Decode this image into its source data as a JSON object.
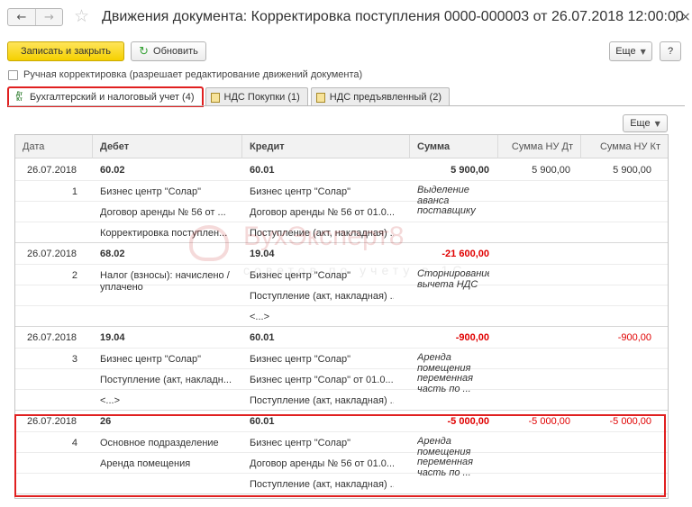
{
  "title": "Движения документа: Корректировка поступления 0000-000003 от 26.07.2018 12:00:00",
  "window": {
    "more_label": "⋮",
    "close_label": "×"
  },
  "toolbar": {
    "save_close": "Записать и закрыть",
    "refresh": "Обновить",
    "more": "Еще",
    "help": "?"
  },
  "manual_correction": {
    "label": "Ручная корректировка (разрешает редактирование движений документа)",
    "checked": false
  },
  "tabs": [
    {
      "label": "Бухгалтерский и налоговый учет (4)",
      "active": true,
      "icon": "dt-kt-icon"
    },
    {
      "label": "НДС Покупки (1)",
      "active": false,
      "icon": "register-icon"
    },
    {
      "label": "НДС предъявленный (2)",
      "active": false,
      "icon": "register-icon"
    }
  ],
  "grid_more": "Еще",
  "columns": [
    "Дата",
    "Дебет",
    "Кредит",
    "Сумма",
    "Сумма НУ Дт",
    "Сумма НУ Кт"
  ],
  "rows": [
    {
      "date": "26.07.2018",
      "num": "1",
      "debit": [
        "60.02",
        "Бизнес центр \"Солар\"",
        "Договор аренды № 56 от ...",
        "Корректировка поступлен..."
      ],
      "credit": [
        "60.01",
        "Бизнес центр \"Солар\"",
        "Договор аренды № 56 от 01.0...",
        "Поступление (акт, накладная) ..."
      ],
      "sum": "5 900,00",
      "content": "Выделение аванса поставщику",
      "nu_dt": "5 900,00",
      "nu_kt": "5 900,00"
    },
    {
      "date": "26.07.2018",
      "num": "2",
      "debit": [
        "68.02",
        "Налог (взносы): начислено / уплачено",
        "",
        ""
      ],
      "credit": [
        "19.04",
        "Бизнес центр \"Солар\"",
        "Поступление (акт, накладная) ...",
        "<...>"
      ],
      "sum": "-21 600,00",
      "content": "Сторнирование вычета НДС",
      "nu_dt": "",
      "nu_kt": ""
    },
    {
      "date": "26.07.2018",
      "num": "3",
      "debit": [
        "19.04",
        "Бизнес центр \"Солар\"",
        "Поступление (акт, накладн...",
        "<...>"
      ],
      "credit": [
        "60.01",
        "Бизнес центр \"Солар\"",
        "Бизнес центр \"Солар\" от 01.0...",
        "Поступление (акт, накладная) ..."
      ],
      "sum": "-900,00",
      "content": "Аренда помещения переменная часть по ...",
      "nu_dt": "",
      "nu_kt": "-900,00"
    },
    {
      "date": "26.07.2018",
      "num": "4",
      "debit": [
        "26",
        "Основное подразделение",
        "Аренда помещения",
        ""
      ],
      "credit": [
        "60.01",
        "Бизнес центр \"Солар\"",
        "Договор аренды № 56 от 01.0...",
        "Поступление (акт, накладная) ..."
      ],
      "sum": "-5 000,00",
      "content": "Аренда помещения переменная часть по ...",
      "nu_dt": "-5 000,00",
      "nu_kt": "-5 000,00"
    }
  ],
  "watermark": {
    "brand": "БухЭксперт8",
    "tagline": "советов по учету в 1С"
  },
  "colors": {
    "accent_red": "#e02020",
    "negative": "#e00000",
    "primary_button": "#f5d000"
  }
}
